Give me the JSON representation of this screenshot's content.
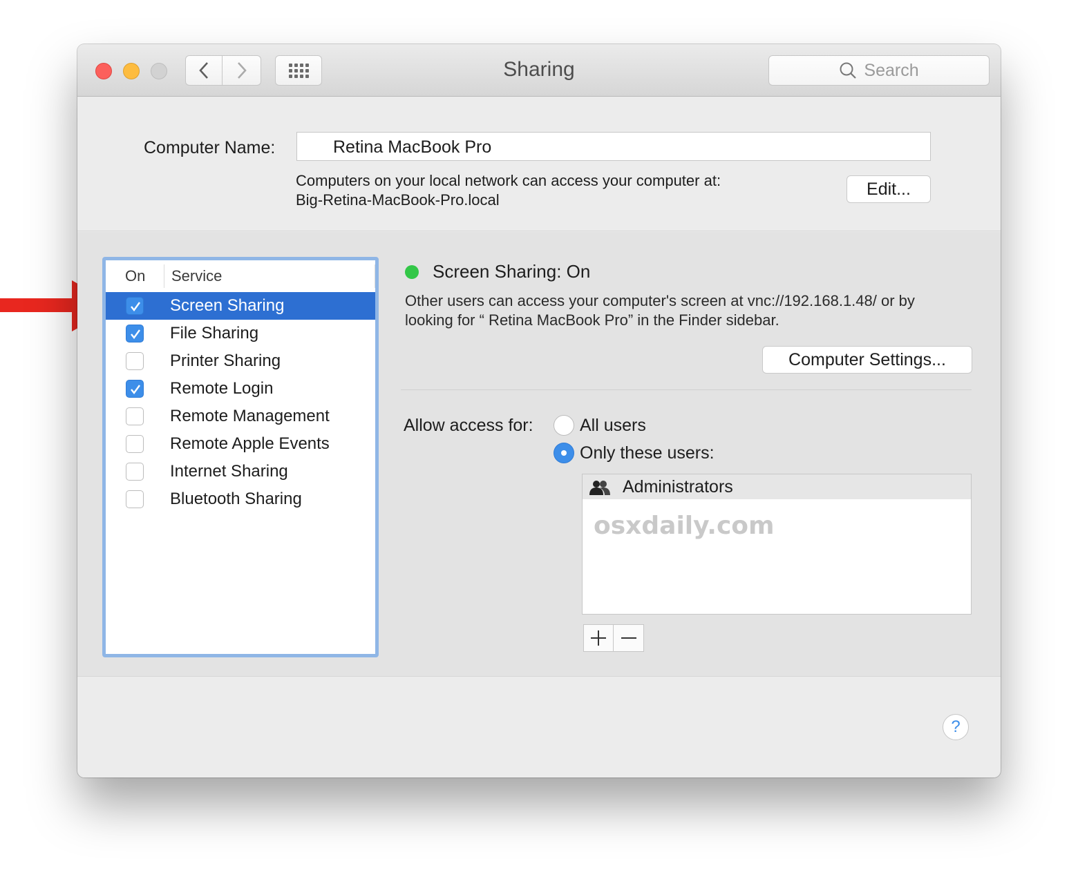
{
  "window": {
    "title": "Sharing",
    "search_placeholder": "Search"
  },
  "computer_name": {
    "label": "Computer Name:",
    "value": "Retina MacBook Pro",
    "description_line1": "Computers on your local network can access your computer at:",
    "description_line2": "Big-Retina-MacBook-Pro.local",
    "edit_label": "Edit..."
  },
  "services": {
    "header_on": "On",
    "header_service": "Service",
    "items": [
      {
        "label": "Screen Sharing",
        "checked": true,
        "selected": true
      },
      {
        "label": "File Sharing",
        "checked": true,
        "selected": false
      },
      {
        "label": "Printer Sharing",
        "checked": false,
        "selected": false
      },
      {
        "label": "Remote Login",
        "checked": true,
        "selected": false
      },
      {
        "label": "Remote Management",
        "checked": false,
        "selected": false
      },
      {
        "label": "Remote Apple Events",
        "checked": false,
        "selected": false
      },
      {
        "label": "Internet Sharing",
        "checked": false,
        "selected": false
      },
      {
        "label": "Bluetooth Sharing",
        "checked": false,
        "selected": false
      }
    ]
  },
  "detail": {
    "status_title": "Screen Sharing: On",
    "status_color": "#33c748",
    "status_desc_line1": "Other users can access your computer's screen at vnc://192.168.1.48/ or by",
    "status_desc_line2": "looking for “      Retina MacBook Pro” in the Finder sidebar.",
    "computer_settings_label": "Computer Settings...",
    "allow_access_label": "Allow access for:",
    "radio_all_users": "All users",
    "radio_only_these": "Only these users:",
    "selected_radio": "only_these",
    "users": [
      "Administrators"
    ],
    "watermark": "osxdaily.com"
  },
  "colors": {
    "selection": "#2d6fd2",
    "checkbox_on": "#3d8ee9",
    "close": "#fc605c",
    "minimize": "#fdbc40",
    "annotation_arrow": "#e8271f"
  },
  "icons": {
    "back": "chevron-left-icon",
    "forward": "chevron-right-icon",
    "show_all": "grid-icon",
    "search": "search-icon",
    "users_group": "users-group-icon",
    "help": "help-icon",
    "annotation": "red-arrow-icon"
  }
}
